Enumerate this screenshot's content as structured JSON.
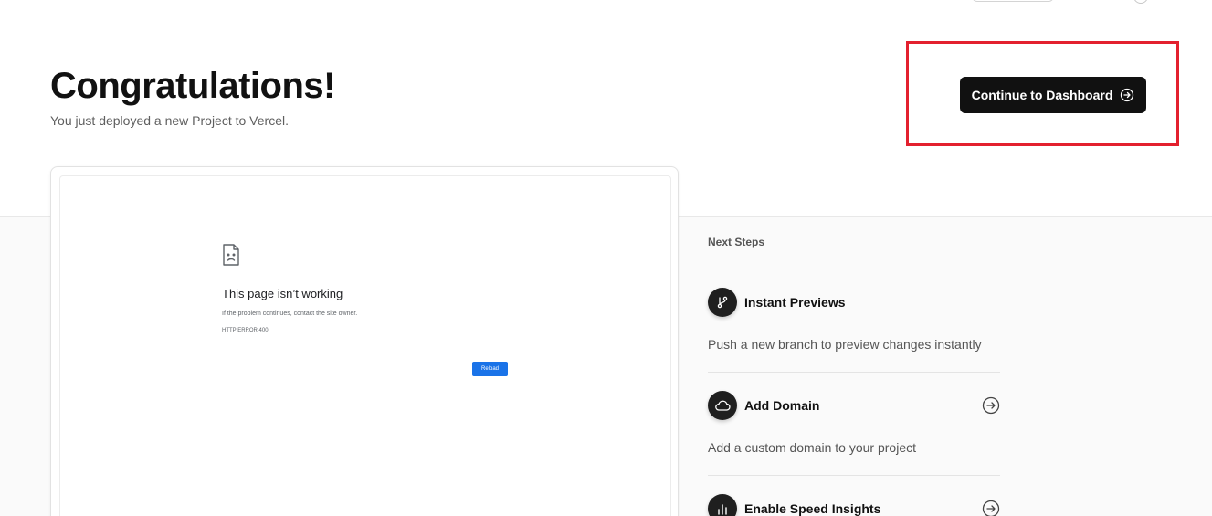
{
  "header": {
    "title": "Congratulations!",
    "subtitle": "You just deployed a new Project to Vercel.",
    "continue_label": "Continue to Dashboard"
  },
  "preview": {
    "error_title": "This page isn’t working",
    "error_description": "If the problem continues, contact the site owner.",
    "error_code": "HTTP ERROR 400",
    "reload_label": "Reload"
  },
  "next_steps": {
    "heading": "Next Steps",
    "items": [
      {
        "title": "Instant Previews",
        "description": "Push a new branch to preview changes instantly",
        "icon": "git-branch-icon"
      },
      {
        "title": "Add Domain",
        "description": "Add a custom domain to your project",
        "icon": "cloud-icon"
      },
      {
        "title": "Enable Speed Insights",
        "description": "",
        "icon": "bar-chart-icon"
      }
    ]
  },
  "colors": {
    "primary_button": "#111111",
    "highlight": "#e3202e",
    "reload_button": "#1a73e8"
  }
}
